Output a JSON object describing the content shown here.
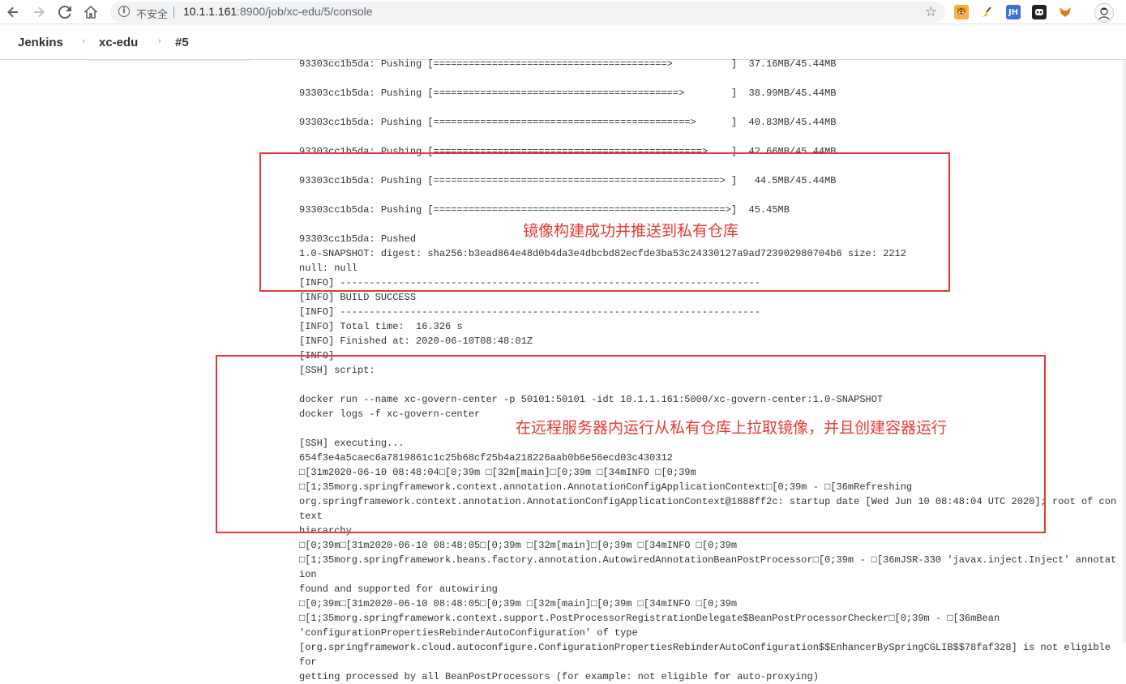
{
  "browser": {
    "security_label": "不安全",
    "url_host": "10.1.1.161",
    "url_path": ":8900/job/xc-edu/5/console",
    "extensions": [
      {
        "icon": "tiger-extension-icon",
        "color": "#f0a030",
        "glyph": "🐯"
      },
      {
        "icon": "broom-extension-icon",
        "color": "#ffffff",
        "glyph": "🧹"
      },
      {
        "icon": "jh-extension-icon",
        "color": "#3d6fd8",
        "glyph": "JH"
      },
      {
        "icon": "ghost-extension-icon",
        "color": "#222222",
        "glyph": "▣"
      },
      {
        "icon": "fox-extension-icon",
        "color": "#e2761b",
        "glyph": "🦊"
      }
    ]
  },
  "breadcrumbs": {
    "jenkins": "Jenkins",
    "job": "xc-edu",
    "build": "#5"
  },
  "console": {
    "lines": [
      "93303cc1b5da: Pushing [========================================>          ]  37.16MB/45.44MB",
      "",
      "93303cc1b5da: Pushing [==========================================>        ]  38.99MB/45.44MB",
      "",
      "93303cc1b5da: Pushing [============================================>      ]  40.83MB/45.44MB",
      "",
      "93303cc1b5da: Pushing [==============================================>    ]  42.66MB/45.44MB",
      "",
      "93303cc1b5da: Pushing [=================================================> ]   44.5MB/45.44MB",
      "",
      "93303cc1b5da: Pushing [==================================================>]  45.45MB",
      "",
      "93303cc1b5da: Pushed",
      "1.0-SNAPSHOT: digest: sha256:b3ead864e48d0b4da3e4dbcbd82ecfde3ba53c24330127a9ad723902980704b6 size: 2212",
      "null: null",
      "[INFO] ------------------------------------------------------------------------",
      "[INFO] BUILD SUCCESS",
      "[INFO] ------------------------------------------------------------------------",
      "[INFO] Total time:  16.326 s",
      "[INFO] Finished at: 2020-06-10T08:48:01Z",
      "[INFO] ------------------------------------------------------------------------",
      "[SSH] script:",
      "",
      "docker run --name xc-govern-center -p 50101:50101 -idt 10.1.1.161:5000/xc-govern-center:1.0-SNAPSHOT",
      "docker logs -f xc-govern-center",
      "",
      "[SSH] executing...",
      "654f3e4a5caec6a7819861c1c25b68cf25b4a218226aab0b6e56ecd03c430312",
      "□[31m2020-06-10 08:48:04□[0;39m □[32m[main]□[0;39m □[34mINFO □[0;39m",
      "□[1;35morg.springframework.context.annotation.AnnotationConfigApplicationContext□[0;39m - □[36mRefreshing",
      "org.springframework.context.annotation.AnnotationConfigApplicationContext@1888ff2c: startup date [Wed Jun 10 08:48:04 UTC 2020]; root of context",
      "hierarchy",
      "□[0;39m□[31m2020-06-10 08:48:05□[0;39m □[32m[main]□[0;39m □[34mINFO □[0;39m",
      "□[1;35morg.springframework.beans.factory.annotation.AutowiredAnnotationBeanPostProcessor□[0;39m - □[36mJSR-330 'javax.inject.Inject' annotation",
      "found and supported for autowiring",
      "□[0;39m□[31m2020-06-10 08:48:05□[0;39m □[32m[main]□[0;39m □[34mINFO □[0;39m",
      "□[1;35morg.springframework.context.support.PostProcessorRegistrationDelegate$BeanPostProcessorChecker□[0;39m - □[36mBean",
      "'configurationPropertiesRebinderAutoConfiguration' of type",
      "[org.springframework.cloud.autoconfigure.ConfigurationPropertiesRebinderAutoConfiguration$$EnhancerBySpringCGLIB$$78faf328] is not eligible for",
      "getting processed by all BeanPostProcessors (for example: not eligible for auto-proxying)"
    ]
  },
  "annotations": [
    {
      "text": "镜像构建成功并推送到私有仓库",
      "color": "#e53935"
    },
    {
      "text": "在远程服务器内运行从私有仓库上拉取镜像，并且创建容器运行",
      "color": "#e53935"
    }
  ]
}
